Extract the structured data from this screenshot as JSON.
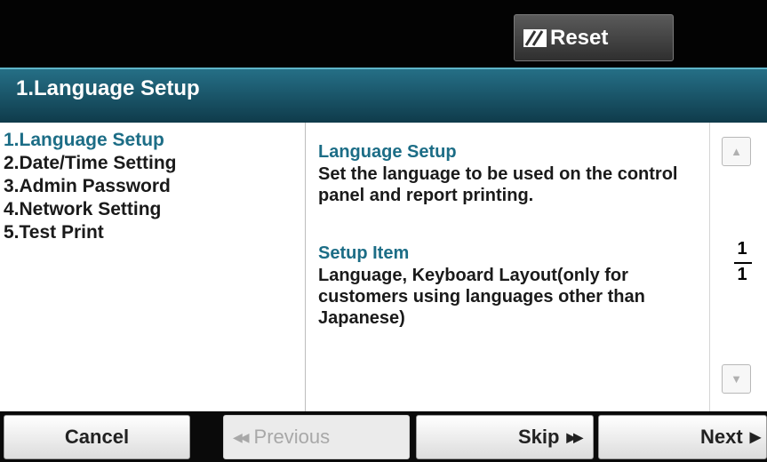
{
  "header": {
    "reset_label": "Reset",
    "reset_icon": "eraser-icon",
    "title": "1.Language Setup"
  },
  "menu": {
    "items": [
      {
        "label": "1.Language Setup",
        "active": true
      },
      {
        "label": "2.Date/Time Setting",
        "active": false
      },
      {
        "label": "3.Admin Password",
        "active": false
      },
      {
        "label": "4.Network Setting",
        "active": false
      },
      {
        "label": "5.Test Print",
        "active": false
      }
    ]
  },
  "description": {
    "heading": "Language Setup",
    "text": "Set the language to be used on the control panel and report printing.",
    "setup_heading": "Setup Item",
    "setup_text": "Language, Keyboard Layout(only for customers using languages other than Japanese)"
  },
  "pager": {
    "current": "1",
    "total": "1",
    "up_icon": "arrow-up-icon",
    "down_icon": "arrow-down-icon"
  },
  "footer": {
    "cancel_label": "Cancel",
    "previous_label": "Previous",
    "previous_icon": "◀◀",
    "skip_label": "Skip",
    "skip_icon": "▶▶",
    "next_label": "Next",
    "next_icon": "▶"
  },
  "colors": {
    "accent": "#1c6d86",
    "titlebar": "#1a5a70"
  }
}
